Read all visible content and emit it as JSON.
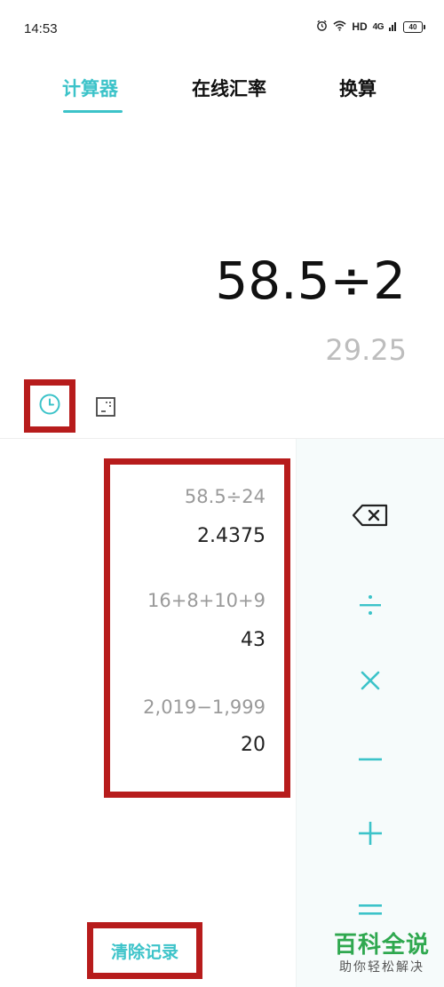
{
  "status_bar": {
    "time": "14:53",
    "network_label": "HD",
    "signal_label": "4G",
    "battery": "40"
  },
  "tabs": [
    {
      "label": "计算器",
      "active": true
    },
    {
      "label": "在线汇率",
      "active": false
    },
    {
      "label": "换算",
      "active": false
    }
  ],
  "display": {
    "expression": "58.5÷2",
    "result_preview": "29.25"
  },
  "toolbar": {
    "history_icon": "clock-icon",
    "mode_icon": "scientific-mode-icon"
  },
  "history": [
    {
      "expression": "58.5÷24",
      "result": "2.4375"
    },
    {
      "expression": "16+8+10+9",
      "result": "43"
    },
    {
      "expression": "2,019−1,999",
      "result": "20"
    }
  ],
  "clear_history_label": "清除记录",
  "operators": [
    {
      "name": "backspace",
      "icon": "backspace-icon"
    },
    {
      "name": "divide",
      "symbol": "÷"
    },
    {
      "name": "multiply",
      "symbol": "×"
    },
    {
      "name": "minus",
      "symbol": "−"
    },
    {
      "name": "plus",
      "symbol": "+"
    },
    {
      "name": "equals",
      "symbol": "="
    }
  ],
  "watermark": {
    "title": "百科全说",
    "subtitle": "助你轻松解决"
  },
  "colors": {
    "accent": "#3cc3c9",
    "highlight_frame": "#b71c1c",
    "watermark_green": "#2fa84f",
    "muted_text": "#9a9a9a"
  }
}
